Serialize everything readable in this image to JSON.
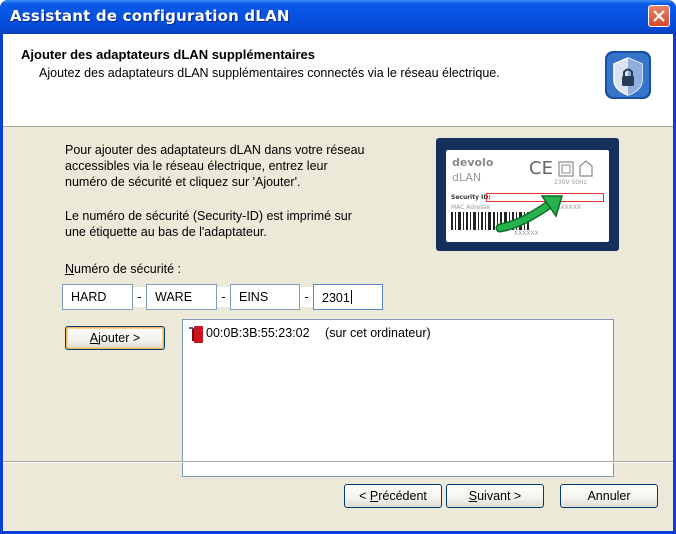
{
  "window": {
    "title": "Assistant de configuration dLAN"
  },
  "header": {
    "title": "Ajouter des adaptateurs dLAN supplémentaires",
    "subtitle": "Ajoutez des adaptateurs dLAN supplémentaires connectés via le réseau électrique."
  },
  "body": {
    "instructions_line1": "Pour ajouter des adaptateurs dLAN dans votre réseau",
    "instructions_line2": "accessibles via le réseau électrique, entrez leur",
    "instructions_line3": "numéro de sécurité et cliquez sur 'Ajouter'.",
    "note_line1": "Le numéro de sécurité (Security-ID) est imprimé sur",
    "note_line2": "une étiquette au bas de l'adaptateur.",
    "security_label_first": "N",
    "security_label_rest": "uméro de sécurité :"
  },
  "label_image": {
    "brand_line1": "devolo",
    "brand_line2": "dLAN",
    "ce_mark": "CE",
    "rating": "230V 50Hz",
    "security_id_label": "Security ID:",
    "mac_label": "MAC Adresse",
    "mac_mask": "XXXXXXXXX",
    "code_mask": "XXXXXX"
  },
  "security_fields": [
    "HARD",
    "WARE",
    "EINS",
    "2301"
  ],
  "separator": "-",
  "add_button": {
    "first": "A",
    "rest": "jouter >"
  },
  "adapters_list": [
    {
      "mac": "00:0B:3B:55:23:02",
      "note": "(sur cet ordinateur)"
    }
  ],
  "buttons": {
    "back_prefix": "< ",
    "back_first": "P",
    "back_rest": "récédent",
    "next_first": "S",
    "next_rest": "uivant >",
    "cancel": "Annuler"
  },
  "colors": {
    "titlebar": "#0652e0",
    "dialog_bg": "#ece9d8",
    "close_button": "#d04a2a",
    "focus_border": "#f3b760"
  }
}
